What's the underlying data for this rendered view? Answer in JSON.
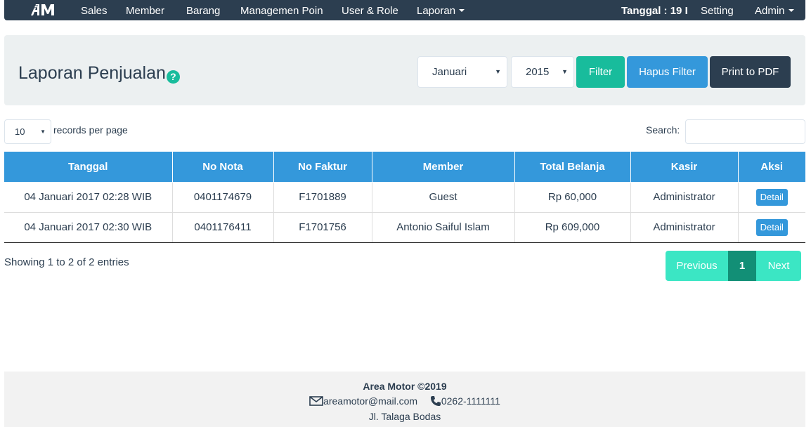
{
  "navbar": {
    "brand": "AM",
    "items": [
      {
        "label": "Sales"
      },
      {
        "label": "Member"
      },
      {
        "label": "Barang"
      },
      {
        "label": "Managemen Poin"
      },
      {
        "label": "User & Role"
      },
      {
        "label": "Laporan"
      }
    ],
    "date_label": "Tanggal : 19 I",
    "setting": "Setting",
    "admin": "Admin"
  },
  "header": {
    "title": "Laporan Penjualan",
    "help_icon": "question-circle-icon",
    "month_select": "Januari",
    "year_select": "2015",
    "filter_button": "Filter",
    "clear_filter_button": "Hapus Filter",
    "pdf_button": "Print to PDF"
  },
  "table_controls": {
    "page_length": "10",
    "page_length_label": "records per page",
    "search_label": "Search:",
    "search_value": ""
  },
  "table": {
    "columns": [
      "Tanggal",
      "No Nota",
      "No Faktur",
      "Member",
      "Total Belanja",
      "Kasir",
      "Aksi"
    ],
    "rows": [
      {
        "tanggal": "04 Januari 2017 02:28 WIB",
        "no_nota": "0401174679",
        "no_faktur": "F1701889",
        "member": "Guest",
        "total": "Rp 60,000",
        "kasir": "Administrator",
        "aksi": "Detail"
      },
      {
        "tanggal": "04 Januari 2017 02:30 WIB",
        "no_nota": "0401176411",
        "no_faktur": "F1701756",
        "member": "Antonio Saiful Islam",
        "total": "Rp 609,000",
        "kasir": "Administrator",
        "aksi": "Detail"
      }
    ]
  },
  "pagination": {
    "info": "Showing 1 to 2 of 2 entries",
    "previous": "Previous",
    "current": "1",
    "next": "Next"
  },
  "footer": {
    "company": "Area Motor ©2019",
    "email": "areamotor@mail.com",
    "phone": "0262-1111111",
    "address": "Jl. Talaga Bodas"
  },
  "colors": {
    "navbar": "#2c3e50",
    "primary": "#3498db",
    "success": "#18bc9c",
    "panel": "#ecf0f1"
  }
}
